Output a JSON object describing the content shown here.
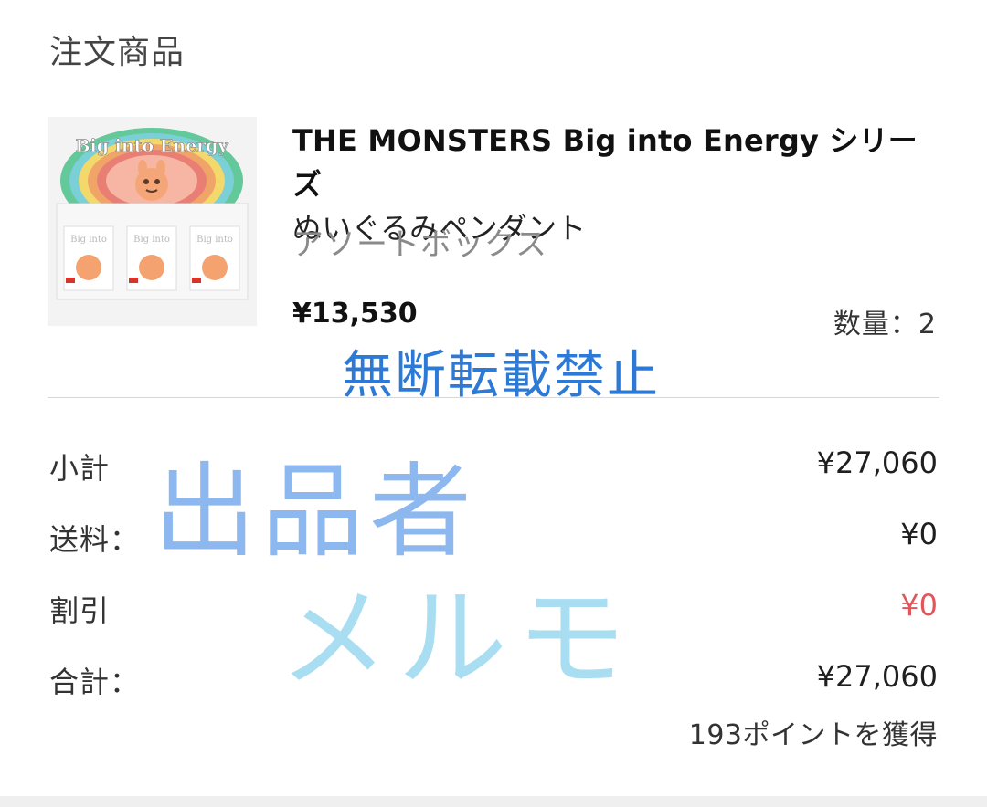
{
  "section_title": "注文商品",
  "product": {
    "name_line1": "THE MONSTERS Big into Energy シリーズ",
    "name_line2": "ぬいぐるみペンダント",
    "variant": "アソートボックス",
    "price": "¥13,530",
    "quantity": "数量：2"
  },
  "summary": {
    "subtotal": {
      "label": "小計",
      "value": "¥27,060"
    },
    "shipping": {
      "label": "送料：",
      "value": "¥0"
    },
    "discount": {
      "label": "割引",
      "value": "¥0"
    },
    "total": {
      "label": "合計：",
      "value": "¥27,060"
    }
  },
  "points": "193ポイントを獲得",
  "watermarks": {
    "line1": "無断転載禁止",
    "line2": "出品者",
    "line3": "メルモ"
  },
  "thumbnail": {
    "banner_text": "Big into Energy",
    "box_text": "Big into Energy"
  },
  "colors": {
    "discount": "#e0565b",
    "watermark_blue": "#2d7ad6",
    "watermark_light_blue": "#8db8ef",
    "watermark_pale_blue": "#a9ddf2"
  }
}
